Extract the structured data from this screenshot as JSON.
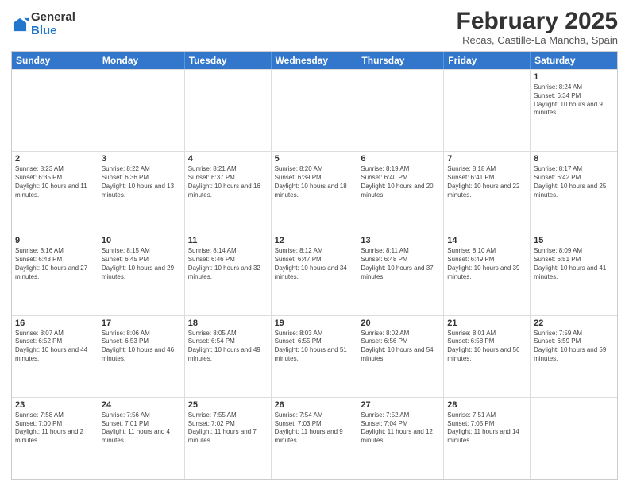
{
  "logo": {
    "general": "General",
    "blue": "Blue"
  },
  "header": {
    "month": "February 2025",
    "location": "Recas, Castille-La Mancha, Spain"
  },
  "weekdays": [
    "Sunday",
    "Monday",
    "Tuesday",
    "Wednesday",
    "Thursday",
    "Friday",
    "Saturday"
  ],
  "weeks": [
    [
      {
        "day": "",
        "info": ""
      },
      {
        "day": "",
        "info": ""
      },
      {
        "day": "",
        "info": ""
      },
      {
        "day": "",
        "info": ""
      },
      {
        "day": "",
        "info": ""
      },
      {
        "day": "",
        "info": ""
      },
      {
        "day": "1",
        "info": "Sunrise: 8:24 AM\nSunset: 6:34 PM\nDaylight: 10 hours and 9 minutes."
      }
    ],
    [
      {
        "day": "2",
        "info": "Sunrise: 8:23 AM\nSunset: 6:35 PM\nDaylight: 10 hours and 11 minutes."
      },
      {
        "day": "3",
        "info": "Sunrise: 8:22 AM\nSunset: 6:36 PM\nDaylight: 10 hours and 13 minutes."
      },
      {
        "day": "4",
        "info": "Sunrise: 8:21 AM\nSunset: 6:37 PM\nDaylight: 10 hours and 16 minutes."
      },
      {
        "day": "5",
        "info": "Sunrise: 8:20 AM\nSunset: 6:39 PM\nDaylight: 10 hours and 18 minutes."
      },
      {
        "day": "6",
        "info": "Sunrise: 8:19 AM\nSunset: 6:40 PM\nDaylight: 10 hours and 20 minutes."
      },
      {
        "day": "7",
        "info": "Sunrise: 8:18 AM\nSunset: 6:41 PM\nDaylight: 10 hours and 22 minutes."
      },
      {
        "day": "8",
        "info": "Sunrise: 8:17 AM\nSunset: 6:42 PM\nDaylight: 10 hours and 25 minutes."
      }
    ],
    [
      {
        "day": "9",
        "info": "Sunrise: 8:16 AM\nSunset: 6:43 PM\nDaylight: 10 hours and 27 minutes."
      },
      {
        "day": "10",
        "info": "Sunrise: 8:15 AM\nSunset: 6:45 PM\nDaylight: 10 hours and 29 minutes."
      },
      {
        "day": "11",
        "info": "Sunrise: 8:14 AM\nSunset: 6:46 PM\nDaylight: 10 hours and 32 minutes."
      },
      {
        "day": "12",
        "info": "Sunrise: 8:12 AM\nSunset: 6:47 PM\nDaylight: 10 hours and 34 minutes."
      },
      {
        "day": "13",
        "info": "Sunrise: 8:11 AM\nSunset: 6:48 PM\nDaylight: 10 hours and 37 minutes."
      },
      {
        "day": "14",
        "info": "Sunrise: 8:10 AM\nSunset: 6:49 PM\nDaylight: 10 hours and 39 minutes."
      },
      {
        "day": "15",
        "info": "Sunrise: 8:09 AM\nSunset: 6:51 PM\nDaylight: 10 hours and 41 minutes."
      }
    ],
    [
      {
        "day": "16",
        "info": "Sunrise: 8:07 AM\nSunset: 6:52 PM\nDaylight: 10 hours and 44 minutes."
      },
      {
        "day": "17",
        "info": "Sunrise: 8:06 AM\nSunset: 6:53 PM\nDaylight: 10 hours and 46 minutes."
      },
      {
        "day": "18",
        "info": "Sunrise: 8:05 AM\nSunset: 6:54 PM\nDaylight: 10 hours and 49 minutes."
      },
      {
        "day": "19",
        "info": "Sunrise: 8:03 AM\nSunset: 6:55 PM\nDaylight: 10 hours and 51 minutes."
      },
      {
        "day": "20",
        "info": "Sunrise: 8:02 AM\nSunset: 6:56 PM\nDaylight: 10 hours and 54 minutes."
      },
      {
        "day": "21",
        "info": "Sunrise: 8:01 AM\nSunset: 6:58 PM\nDaylight: 10 hours and 56 minutes."
      },
      {
        "day": "22",
        "info": "Sunrise: 7:59 AM\nSunset: 6:59 PM\nDaylight: 10 hours and 59 minutes."
      }
    ],
    [
      {
        "day": "23",
        "info": "Sunrise: 7:58 AM\nSunset: 7:00 PM\nDaylight: 11 hours and 2 minutes."
      },
      {
        "day": "24",
        "info": "Sunrise: 7:56 AM\nSunset: 7:01 PM\nDaylight: 11 hours and 4 minutes."
      },
      {
        "day": "25",
        "info": "Sunrise: 7:55 AM\nSunset: 7:02 PM\nDaylight: 11 hours and 7 minutes."
      },
      {
        "day": "26",
        "info": "Sunrise: 7:54 AM\nSunset: 7:03 PM\nDaylight: 11 hours and 9 minutes."
      },
      {
        "day": "27",
        "info": "Sunrise: 7:52 AM\nSunset: 7:04 PM\nDaylight: 11 hours and 12 minutes."
      },
      {
        "day": "28",
        "info": "Sunrise: 7:51 AM\nSunset: 7:05 PM\nDaylight: 11 hours and 14 minutes."
      },
      {
        "day": "",
        "info": ""
      }
    ]
  ]
}
